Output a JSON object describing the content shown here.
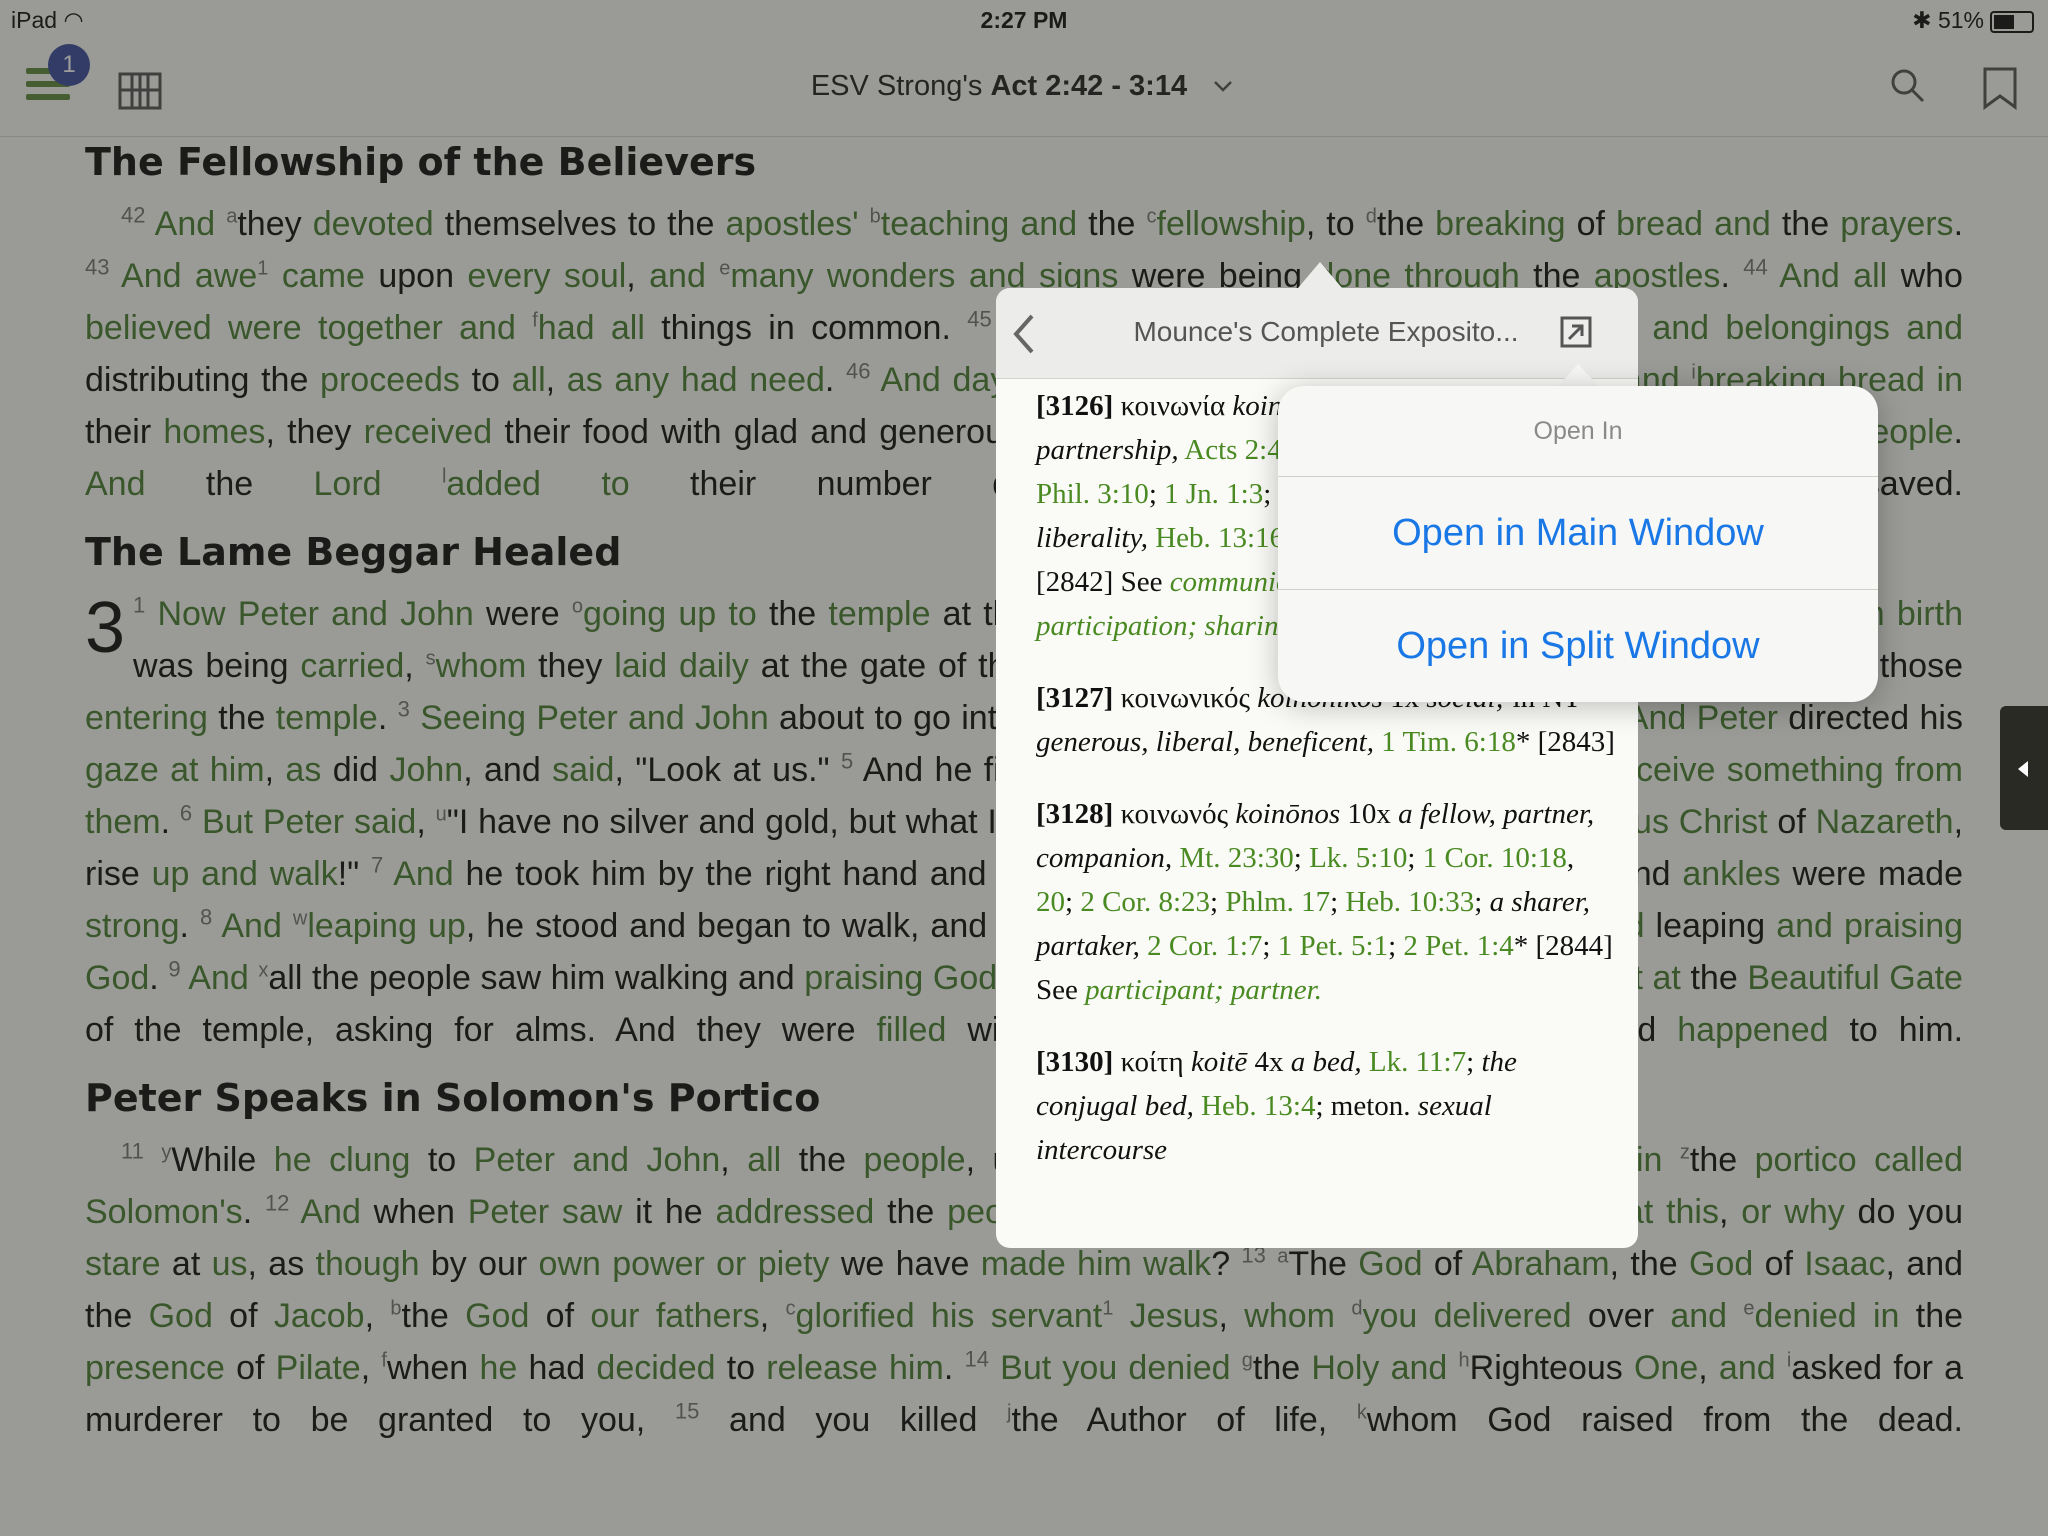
{
  "status": {
    "device": "iPad",
    "time": "2:27 PM",
    "battery": "51%",
    "battery_level": 0.51
  },
  "toolbar": {
    "badge": "1",
    "resource": "ESV Strong's",
    "reference": "Act 2:42 - 3:14",
    "icons": [
      "menu-icon",
      "library-icon",
      "chevron-down-icon",
      "search-icon",
      "bookmark-icon"
    ]
  },
  "colors": {
    "link": "#4a7e32",
    "ios_blue": "#1a78e6",
    "badge": "#3e4d9e"
  },
  "headings": {
    "h1": "The Fellowship of the Believers",
    "h2": "The Lame Beggar Healed",
    "h3": "Peter Speaks in Solomon's Portico"
  },
  "popover": {
    "title": "Mounce's Complete Exposito...",
    "open_in": {
      "header": "Open In",
      "main": "Open in Main Window",
      "split": "Open in Split Window"
    }
  }
}
